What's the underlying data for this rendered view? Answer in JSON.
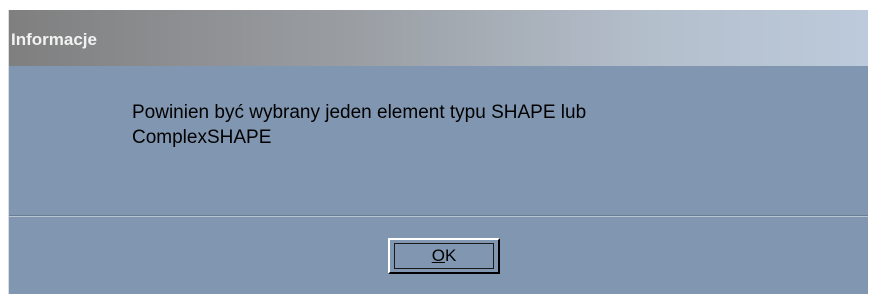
{
  "dialog": {
    "title": "Informacje",
    "message_line1": "Powinien być wybrany jeden element typu SHAPE lub",
    "message_line2": "ComplexSHAPE",
    "ok_button": {
      "mnemonic": "O",
      "rest": "K"
    }
  },
  "colors": {
    "dialog_background": "#8196b0",
    "title_text": "#f2f2f2",
    "message_text": "#000000"
  }
}
